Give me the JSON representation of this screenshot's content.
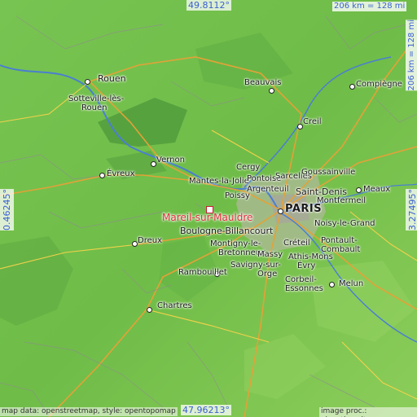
{
  "map": {
    "lat_top": "49.8112°",
    "lat_bottom": "47.96213°",
    "lon_left": "0.46245°",
    "lon_right": "3.27495°",
    "scale_horizontal": "206 km = 128 mi",
    "scale_vertical": "206 km = 128 mi",
    "credit_left": "map data: openstreetmap, style: opentopomap",
    "credit_right": "image proc.: elevation.city",
    "highlight_color": "#e0303a"
  },
  "places": {
    "rouen": "Rouen",
    "sotteville_1": "Sotteville-lès-",
    "sotteville_2": "Rouen",
    "beauvais": "Beauvais",
    "compiegne": "Compiègne",
    "creil": "Creil",
    "vernon": "Vernon",
    "evreux": "Évreux",
    "mantes": "Mantes-la-Jolie",
    "cergy": "Cergy",
    "pontoise": "Pontoise",
    "sarcelles": "Sarcelles",
    "goussainville": "Goussainville",
    "argenteuil": "Argenteuil",
    "poissy": "Poissy",
    "saint_denis": "Saint-Denis",
    "meaux": "Meaux",
    "montfermeil": "Montfermeil",
    "paris": "PARIS",
    "mareil": "Mareil-sur-Mauldre",
    "noisy": "Noisy-le-Grand",
    "boulogne": "Boulogne-Billancourt",
    "dreux": "Dreux",
    "montigny_1": "Montigny-le-",
    "montigny_2": "Bretonneux",
    "creteil": "Créteil",
    "pontault_1": "Pontault-",
    "pontault_2": "Combault",
    "massy": "Massy",
    "athis": "Athis-Mons",
    "savigny_1": "Savigny-sur-",
    "savigny_2": "Orge",
    "evry": "Évry",
    "rambouillet": "Rambouillet",
    "corbeil_1": "Corbeil-",
    "corbeil_2": "Essonnes",
    "melun": "Melun",
    "chartres": "Chartres"
  }
}
